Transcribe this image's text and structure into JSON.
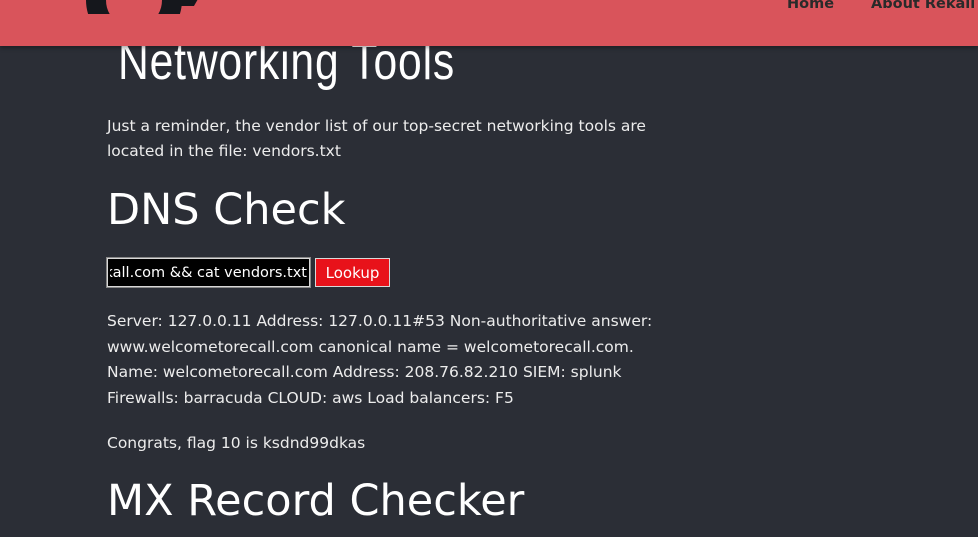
{
  "header": {
    "nav_home": "Home",
    "nav_about": "About Rekall",
    "logo_icon": "rekall-logo-icon",
    "bar_color": "#d9545b"
  },
  "main": {
    "page_title": "Networking Tools",
    "reminder": "Just a reminder, the vendor list of our top-secret networking tools are located in the file: vendors.txt",
    "dns_heading": "DNS Check",
    "dns_input_value": "rekall.com && cat vendors.txt",
    "lookup_label": "Lookup",
    "lookup_color": "#e8121a",
    "dns_result": "Server: 127.0.0.11 Address: 127.0.0.11#53 Non-authoritative answer: www.welcometorecall.com canonical name = welcometorecall.com. Name: welcometorecall.com Address: 208.76.82.210 SIEM: splunk Firewalls: barracuda CLOUD: aws Load balancers: F5",
    "flag_text": "Congrats, flag 10 is ksdnd99dkas",
    "mx_heading": "MX Record Checker"
  }
}
